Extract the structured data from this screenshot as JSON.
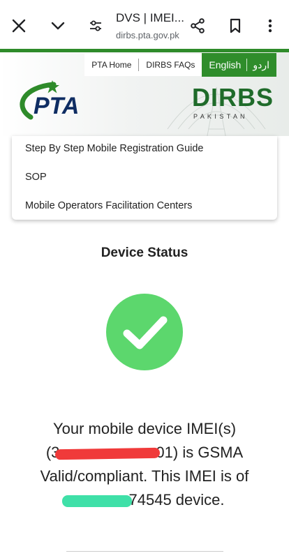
{
  "browser": {
    "title": "DVS | IMEI...",
    "url": "dirbs.pta.gov.pk",
    "icons": [
      "close-icon",
      "chevron-down-icon",
      "tune-icon",
      "share-icon",
      "bookmark-icon",
      "more-vert-icon"
    ]
  },
  "header": {
    "nav_links": [
      "PTA Home",
      "DIRBS FAQs"
    ],
    "lang_english": "English",
    "lang_urdu": "اردو",
    "pta_logo_text": "PTA",
    "dirbs_logo_text": "DIRBS",
    "dirbs_logo_sub": "P A K I S T A N"
  },
  "menu": {
    "items": [
      "Step By Step Mobile Registration Guide",
      "SOP",
      "Mobile Operators Facilitation Centers"
    ]
  },
  "status": {
    "title": "Device Status",
    "line1": "Your mobile device IMEI(s)",
    "imei_prefix": "(3",
    "imei_suffix": "01) is GSMA",
    "line3": "Valid/compliant. This IMEI is of",
    "device_suffix": "74545 device."
  },
  "colors": {
    "brand_green": "#2f8d2b",
    "check_green": "#5cd76d",
    "redaction_red": "#f03a3a",
    "redaction_green": "#3fe0a8"
  }
}
